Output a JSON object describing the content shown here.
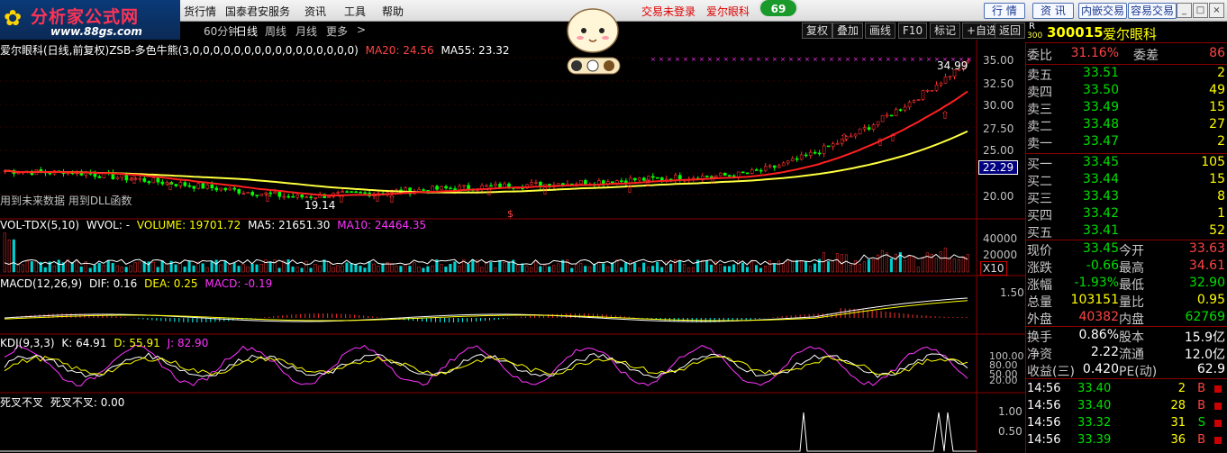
{
  "app": {
    "logo_text": "分析家公式网",
    "logo_url": "www.88gs.com",
    "menu": [
      "货行情",
      "国泰君安服务",
      "资讯",
      "工具",
      "帮助"
    ],
    "links": [
      "交易未登录",
      "爱尔眼科"
    ],
    "badge": "69",
    "buttons": [
      "行 情",
      "资 讯",
      "内嵌交易",
      "容易交易"
    ],
    "win_controls": [
      "_",
      "□",
      "×"
    ]
  },
  "periods": {
    "items": [
      "60分钟",
      "日线",
      "周线",
      "月线",
      "更多"
    ],
    "arrow": ">",
    "active": "日线",
    "tools": [
      "复权",
      "叠加",
      "画线",
      "F10",
      "标记",
      "+自选",
      "返回"
    ]
  },
  "main_chart": {
    "title": "爱尔眼科(日线,前复权)",
    "indicator": "ZSB-多色牛熊(3,0,0,0,0,0,0,0,0,0,0,0,0,0,0,0,0)",
    "ma20": "MA20: 24.56",
    "ma55": "MA55: 23.32",
    "note": "用到未来数据 用到DLL函数",
    "high_label": "34.99",
    "low_label": "19.14",
    "dollar_mark": "$",
    "price_tag": "22.29",
    "y_ticks": [
      "35.00",
      "32.50",
      "30.00",
      "27.50",
      "25.00",
      "22.50",
      "20.00"
    ]
  },
  "vol_panel": {
    "caption": "VOL-TDX(5,10)",
    "wvol": "WVOL: -",
    "volume": "VOLUME: 19701.72",
    "ma5": "MA5: 21651.30",
    "ma10": "MA10: 24464.35",
    "y_ticks": [
      "40000",
      "20000"
    ],
    "unit": "X10"
  },
  "macd_panel": {
    "caption": "MACD(12,26,9)",
    "dif": "DIF: 0.16",
    "dea": "DEA: 0.25",
    "macd": "MACD: -0.19",
    "y_ticks": [
      "1.50"
    ]
  },
  "kdj_panel": {
    "caption": "KDJ(9,3,3)",
    "k": "K: 64.91",
    "d": "D: 55.91",
    "j": "J: 82.90",
    "y_ticks": [
      "100.00",
      "80.00",
      "50.00",
      "20.00"
    ]
  },
  "sc_panel": {
    "caption": "死叉不叉",
    "value": "死叉不叉: 0.00",
    "y_ticks": [
      "1.00",
      "0.50"
    ]
  },
  "quote": {
    "market": "R",
    "market_sub": "300",
    "code": "300015",
    "name": "爱尔眼科",
    "wb_label": "委比",
    "wb": "31.16%",
    "wc_label": "委差",
    "wc": "86",
    "asks": [
      {
        "label": "卖五",
        "price": "33.51",
        "vol": "2"
      },
      {
        "label": "卖四",
        "price": "33.50",
        "vol": "49"
      },
      {
        "label": "卖三",
        "price": "33.49",
        "vol": "15"
      },
      {
        "label": "卖二",
        "price": "33.48",
        "vol": "27"
      },
      {
        "label": "卖一",
        "price": "33.47",
        "vol": "2"
      }
    ],
    "bids": [
      {
        "label": "买一",
        "price": "33.45",
        "vol": "105"
      },
      {
        "label": "买二",
        "price": "33.44",
        "vol": "15"
      },
      {
        "label": "买三",
        "price": "33.43",
        "vol": "8"
      },
      {
        "label": "买四",
        "price": "33.42",
        "vol": "1"
      },
      {
        "label": "买五",
        "price": "33.41",
        "vol": "52"
      }
    ],
    "stats1": [
      {
        "l1": "现价",
        "v1": "33.45",
        "l2": "今开",
        "v2": "33.63"
      },
      {
        "l1": "涨跌",
        "v1": "-0.66",
        "l2": "最高",
        "v2": "34.61"
      },
      {
        "l1": "涨幅",
        "v1": "-1.93%",
        "l2": "最低",
        "v2": "32.90"
      },
      {
        "l1": "总量",
        "v1": "103151",
        "l2": "量比",
        "v2": "0.95"
      },
      {
        "l1": "外盘",
        "v1": "40382",
        "l2": "内盘",
        "v2": "62769"
      }
    ],
    "stats2": [
      {
        "l1": "换手",
        "v1": "0.86%",
        "l2": "股本",
        "v2": "15.9亿"
      },
      {
        "l1": "净资",
        "v1": "2.22",
        "l2": "流通",
        "v2": "12.0亿"
      },
      {
        "l1": "收益(三)",
        "v1": "0.420",
        "l2": "PE(动)",
        "v2": "62.9"
      }
    ],
    "ticks": [
      {
        "time": "14:56",
        "price": "33.40",
        "vol": "2",
        "side": "B"
      },
      {
        "time": "14:56",
        "price": "33.40",
        "vol": "28",
        "side": "B"
      },
      {
        "time": "14:56",
        "price": "33.32",
        "vol": "31",
        "side": "S"
      },
      {
        "time": "14:56",
        "price": "33.39",
        "vol": "36",
        "side": "B"
      }
    ]
  },
  "colors": {
    "up": "#ff4444",
    "down": "#00e000",
    "ma20": "#ff2020",
    "ma55": "#ffff40",
    "accent": "#ffff00"
  }
}
